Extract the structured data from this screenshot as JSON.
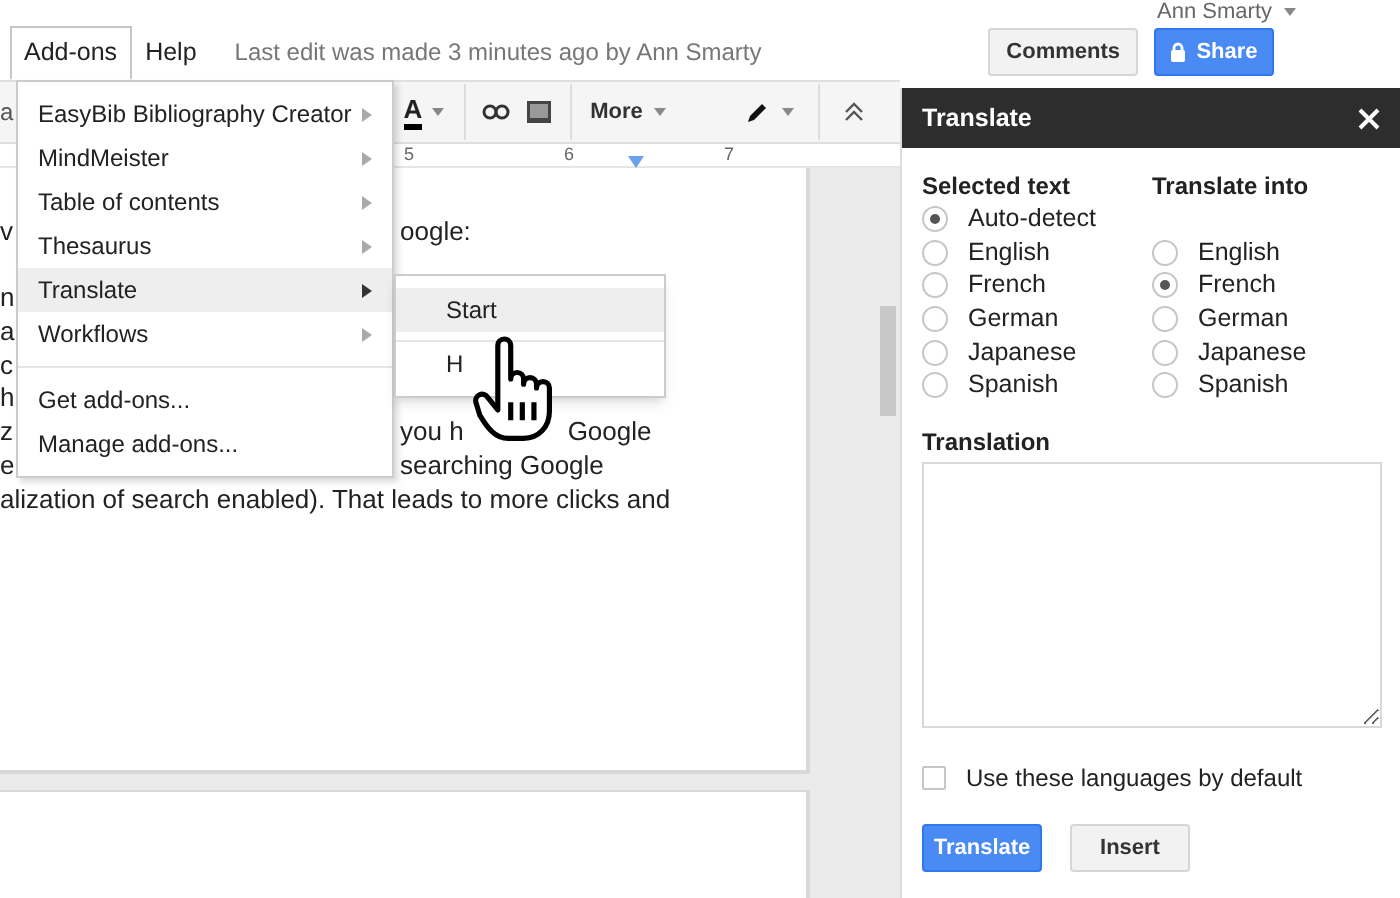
{
  "menubar": [
    {
      "label": "Add-ons",
      "selected": true
    },
    {
      "label": "Help",
      "selected": false
    }
  ],
  "last_edit": "Last edit was made 3 minutes ago by Ann Smarty",
  "user": "Ann Smarty",
  "comments_button": "Comments",
  "share_button": "Share",
  "toolbar": {
    "fragment": "a",
    "text_color": "A",
    "more": "More"
  },
  "ruler": [
    "5",
    "6",
    "7"
  ],
  "document_lines": [
    {
      "kind": "split",
      "left": "v",
      "right": [
        "oogle:"
      ]
    },
    {
      "kind": "split"
    },
    {
      "kind": "split",
      "left": "n"
    },
    {
      "kind": "split",
      "left": "a"
    },
    {
      "kind": "split",
      "left": "c"
    },
    {
      "kind": "split",
      "left": "h"
    },
    {
      "kind": "split",
      "left": "z",
      "right": [
        "you h",
        "Google"
      ]
    },
    {
      "kind": "split",
      "left": "e",
      "right": [
        "searching Google"
      ]
    },
    {
      "kind": "full",
      "text": "alization of search enabled). That leads to more clicks and"
    }
  ],
  "addons_menu": {
    "groups": [
      [
        {
          "label": "EasyBib Bibliography Creator",
          "submenu": true,
          "selected": false
        },
        {
          "label": "MindMeister",
          "submenu": true,
          "selected": false
        },
        {
          "label": "Table of contents",
          "submenu": true,
          "selected": false
        },
        {
          "label": "Thesaurus",
          "submenu": true,
          "selected": false
        },
        {
          "label": "Translate",
          "submenu": true,
          "selected": true
        },
        {
          "label": "Workflows",
          "submenu": true,
          "selected": false
        }
      ],
      [
        {
          "label": "Get add-ons...",
          "submenu": false,
          "selected": false
        },
        {
          "label": "Manage add-ons...",
          "submenu": false,
          "selected": false
        }
      ]
    ]
  },
  "submenu": [
    {
      "label": "Start",
      "selected": true
    },
    {
      "label": "H",
      "selected": false
    }
  ],
  "panel": {
    "title": "Translate",
    "source": {
      "heading": "Selected text",
      "options": [
        {
          "label": "Auto-detect",
          "selected": true
        },
        {
          "label": "English",
          "selected": false
        },
        {
          "label": "French",
          "selected": false
        },
        {
          "label": "German",
          "selected": false
        },
        {
          "label": "Japanese",
          "selected": false
        },
        {
          "label": "Spanish",
          "selected": false
        }
      ]
    },
    "target": {
      "heading": "Translate into",
      "options": [
        {
          "label": "English",
          "selected": false
        },
        {
          "label": "French",
          "selected": true
        },
        {
          "label": "German",
          "selected": false
        },
        {
          "label": "Japanese",
          "selected": false
        },
        {
          "label": "Spanish",
          "selected": false
        }
      ]
    },
    "translation_label": "Translation",
    "default_checkbox": {
      "label": "Use these languages by default",
      "checked": false
    },
    "buttons": [
      {
        "label": "Translate",
        "kind": "primary"
      },
      {
        "label": "Insert",
        "kind": "secondary"
      }
    ]
  }
}
